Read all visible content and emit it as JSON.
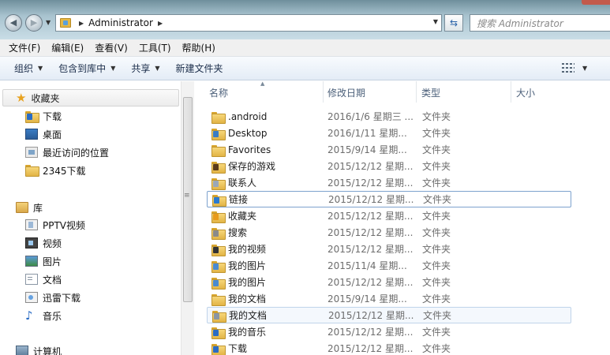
{
  "address": {
    "path": [
      "Administrator"
    ],
    "search_placeholder": "搜索 Administrator"
  },
  "menu": [
    "文件(F)",
    "编辑(E)",
    "查看(V)",
    "工具(T)",
    "帮助(H)"
  ],
  "commands": [
    {
      "label": "组织",
      "has_caret": true
    },
    {
      "label": "包含到库中",
      "has_caret": true
    },
    {
      "label": "共享",
      "has_caret": true
    },
    {
      "label": "新建文件夹",
      "has_caret": false
    }
  ],
  "nav": {
    "favorites": {
      "label": "收藏夹",
      "items": [
        {
          "label": "下载",
          "icon": "download-folder-icon"
        },
        {
          "label": "桌面",
          "icon": "desktop-icon"
        },
        {
          "label": "最近访问的位置",
          "icon": "recent-places-icon"
        },
        {
          "label": "2345下载",
          "icon": "folder-icon"
        }
      ]
    },
    "libraries": {
      "label": "库",
      "items": [
        {
          "label": "PPTV视频",
          "icon": "pptv-icon"
        },
        {
          "label": "视频",
          "icon": "video-icon"
        },
        {
          "label": "图片",
          "icon": "picture-icon"
        },
        {
          "label": "文档",
          "icon": "document-icon"
        },
        {
          "label": "迅雷下载",
          "icon": "thunder-download-icon"
        },
        {
          "label": "音乐",
          "icon": "music-icon"
        }
      ]
    },
    "computer": {
      "label": "计算机"
    }
  },
  "columns": [
    "名称",
    "修改日期",
    "类型",
    "大小"
  ],
  "files": [
    {
      "name": ".android",
      "date": "2016/1/6 星期三 ...",
      "type": "文件夹",
      "mark": ""
    },
    {
      "name": "Desktop",
      "date": "2016/1/11 星期...",
      "type": "文件夹",
      "mark": "#3a7cc4"
    },
    {
      "name": "Favorites",
      "date": "2015/9/14 星期...",
      "type": "文件夹",
      "mark": ""
    },
    {
      "name": "保存的游戏",
      "date": "2015/12/12 星期...",
      "type": "文件夹",
      "mark": "#5a3a1a"
    },
    {
      "name": "联系人",
      "date": "2015/12/12 星期...",
      "type": "文件夹",
      "mark": "#9aa7b8"
    },
    {
      "name": "链接",
      "date": "2015/12/12 星期...",
      "type": "文件夹",
      "mark": "#2a7ad0"
    },
    {
      "name": "收藏夹",
      "date": "2015/12/12 星期...",
      "type": "文件夹",
      "mark": "#e89a1a"
    },
    {
      "name": "搜索",
      "date": "2015/12/12 星期...",
      "type": "文件夹",
      "mark": "#8a8a8a"
    },
    {
      "name": "我的视频",
      "date": "2015/12/12 星期...",
      "type": "文件夹",
      "mark": "#333333"
    },
    {
      "name": "我的图片",
      "date": "2015/11/4 星期...",
      "type": "文件夹",
      "mark": "#4a8ad0"
    },
    {
      "name": "我的图片",
      "date": "2015/12/12 星期...",
      "type": "文件夹",
      "mark": "#4a8ad0"
    },
    {
      "name": "我的文档",
      "date": "2015/9/14 星期...",
      "type": "文件夹",
      "mark": ""
    },
    {
      "name": "我的文档",
      "date": "2015/12/12 星期...",
      "type": "文件夹",
      "mark": "#8a96a4"
    },
    {
      "name": "我的音乐",
      "date": "2015/12/12 星期...",
      "type": "文件夹",
      "mark": "#2a6cc4"
    },
    {
      "name": "下载",
      "date": "2015/12/12 星期...",
      "type": "文件夹",
      "mark": "#2a6cc4"
    }
  ],
  "selected_index": 5,
  "hover_index": 12
}
